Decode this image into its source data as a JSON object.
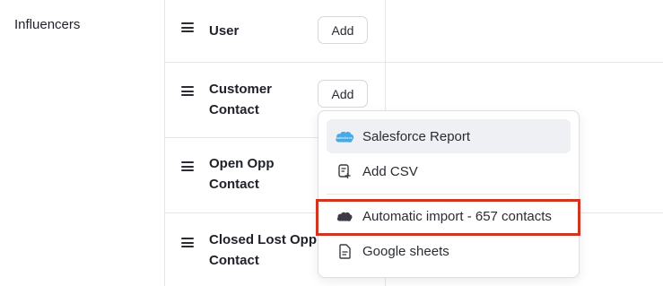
{
  "section": {
    "title": "Influencers"
  },
  "rows": [
    {
      "label_line1": "User",
      "label_line2": "",
      "add_label": "Add"
    },
    {
      "label_line1": "Customer",
      "label_line2": "Contact",
      "add_label": "Add"
    },
    {
      "label_line1": "Open Opp",
      "label_line2": "Contact"
    },
    {
      "label_line1": "Closed Lost Opp",
      "label_line2": "Contact"
    }
  ],
  "menu": {
    "items": [
      {
        "label": "Salesforce Report",
        "icon": "salesforce-cloud-icon"
      },
      {
        "label": "Add CSV",
        "icon": "document-add-icon"
      },
      {
        "label": "Automatic import - 657 contacts",
        "icon": "salesforce-cloud-icon"
      },
      {
        "label": "Google sheets",
        "icon": "document-icon"
      }
    ]
  },
  "colors": {
    "highlight_border": "#d0361f",
    "salesforce_blue": "#47a9e6",
    "hover_bg": "#eef0f4"
  }
}
